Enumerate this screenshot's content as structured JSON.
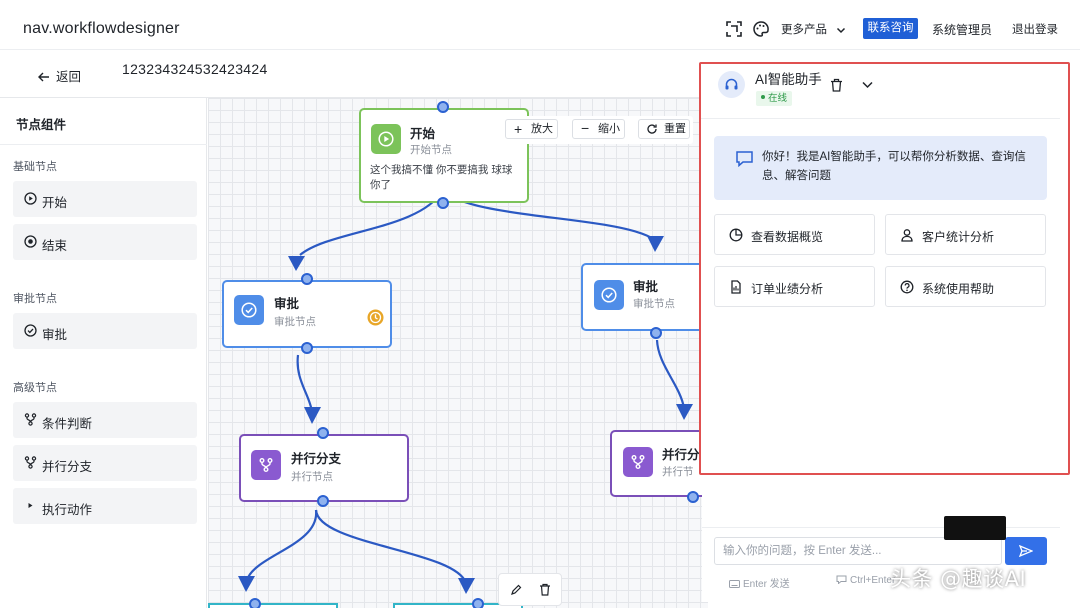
{
  "topbar": {
    "brand": "nav.workflowdesigner",
    "more_products": "更多产品",
    "contact": "联系咨询",
    "user": "系统管理员",
    "logout": "退出登录"
  },
  "subheader": {
    "back": "返回",
    "workflow_id": "123234324532423424"
  },
  "sidebar": {
    "title": "节点组件",
    "sections": [
      {
        "label": "基础节点",
        "items": [
          {
            "label": "开始",
            "icon": "play-circle-icon"
          },
          {
            "label": "结束",
            "icon": "stop-circle-icon"
          }
        ]
      },
      {
        "label": "审批节点",
        "items": [
          {
            "label": "审批",
            "icon": "check-circle-icon"
          }
        ]
      },
      {
        "label": "高级节点",
        "items": [
          {
            "label": "条件判断",
            "icon": "branch-icon"
          },
          {
            "label": "并行分支",
            "icon": "branch-icon"
          },
          {
            "label": "执行动作",
            "icon": "play-triangle-icon"
          }
        ]
      }
    ]
  },
  "canvas": {
    "toolbar": {
      "zoom_in": "放大",
      "zoom_out": "缩小",
      "reset": "重置"
    },
    "nodes": {
      "start": {
        "title": "开始",
        "subtitle": "开始节点",
        "desc": "这个我搞不懂 你不要搞我 球球你了"
      },
      "approve_left": {
        "title": "审批",
        "subtitle": "审批节点"
      },
      "approve_right": {
        "title": "审批",
        "subtitle": "审批节点"
      },
      "parallel_left": {
        "title": "并行分支",
        "subtitle": "并行节点"
      },
      "parallel_right": {
        "title": "并行分",
        "subtitle": "并行节"
      }
    }
  },
  "ai": {
    "title": "AI智能助手",
    "status": "在线",
    "greeting": "你好！我是AI智能助手，可以帮你分析数据、查询信息、解答问题",
    "quick_actions": [
      {
        "label": "查看数据概览",
        "icon": "chart-pie-icon"
      },
      {
        "label": "客户统计分析",
        "icon": "user-icon"
      },
      {
        "label": "订单业绩分析",
        "icon": "document-icon"
      },
      {
        "label": "系统使用帮助",
        "icon": "help-circle-icon"
      }
    ],
    "input_placeholder": "输入你的问题，按 Enter 发送...",
    "hint_enter": "Enter 发送",
    "hint_ctrl": "Ctrl+Enter"
  },
  "watermark": "头条 @趣谈AI",
  "colors": {
    "accent": "#1f5fd6",
    "highlight_border": "#e05050",
    "edge": "#2b59c3",
    "start_border": "#7cc35a",
    "approve_border": "#4f8de8",
    "parallel_border": "#7a4fb8"
  }
}
